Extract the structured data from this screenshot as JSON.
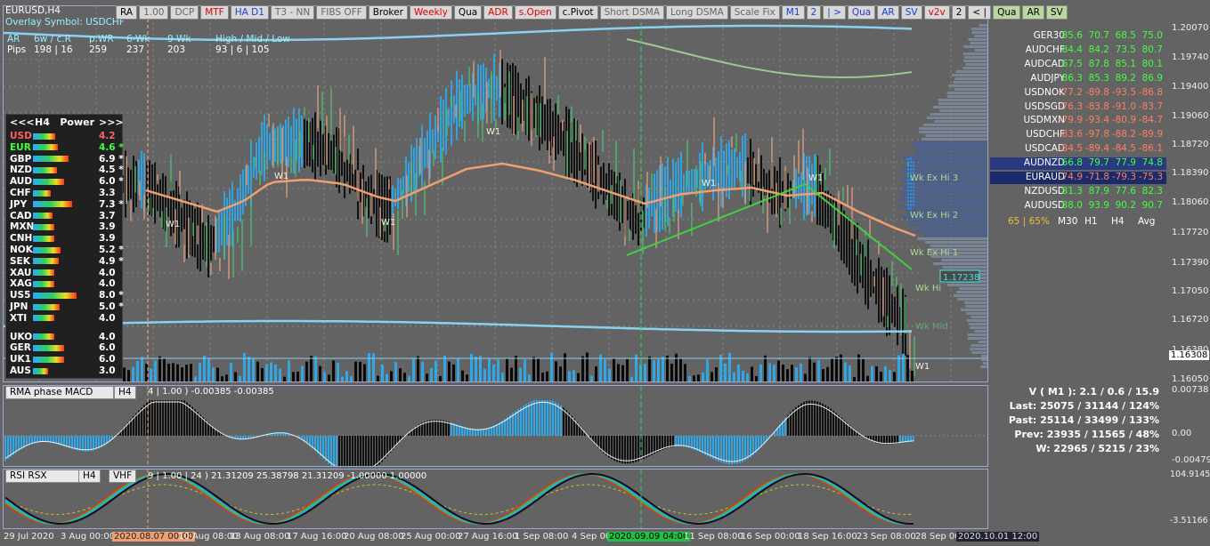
{
  "header": {
    "symbol": "EURUSD,H4",
    "overlay": "Overlay Symbol: USDCHF",
    "ar_label": "AR",
    "pips_label": "Pips",
    "cols": [
      {
        "h": "6w / c.R",
        "v": "198 | 16"
      },
      {
        "h": "p.WR",
        "v": "259"
      },
      {
        "h": "6-Wk",
        "v": "237"
      },
      {
        "h": "9-Wk",
        "v": "203"
      },
      {
        "h": "High / Mid / Low",
        "v": "93 | 6 | 105"
      }
    ]
  },
  "toolbar": [
    {
      "label": "RA",
      "style": ""
    },
    {
      "label": "1.00",
      "style": "gray"
    },
    {
      "label": "DCP",
      "style": "gray"
    },
    {
      "label": "MTF",
      "style": "red"
    },
    {
      "label": "HA D1",
      "style": "blue"
    },
    {
      "label": "T3 - NN",
      "style": "gray"
    },
    {
      "label": "FIBS OFF",
      "style": "gray"
    },
    {
      "label": "Broker",
      "style": ""
    },
    {
      "label": "Weekly",
      "style": "red"
    },
    {
      "label": "Qua",
      "style": ""
    },
    {
      "label": "ADR",
      "style": "red"
    },
    {
      "label": "s.Open",
      "style": "red"
    },
    {
      "label": "c.Pivot",
      "style": ""
    },
    {
      "label": "Short DSMA",
      "style": "gray"
    },
    {
      "label": "Long DSMA",
      "style": "gray"
    },
    {
      "label": "Scale Fix",
      "style": "gray"
    },
    {
      "label": "M1",
      "style": "blue"
    },
    {
      "label": "2",
      "style": "blue"
    },
    {
      "label": "| >",
      "style": "blue"
    },
    {
      "label": "Qua",
      "style": "blue"
    },
    {
      "label": "AR",
      "style": "blue"
    },
    {
      "label": "SV",
      "style": "blue"
    },
    {
      "label": "v2v",
      "style": "red"
    },
    {
      "label": "2",
      "style": ""
    },
    {
      "label": "< |",
      "style": ""
    },
    {
      "label": "Qua",
      "style": "green"
    },
    {
      "label": "AR",
      "style": "green"
    },
    {
      "label": "SV",
      "style": "green"
    }
  ],
  "price_axis": {
    "main": [
      "1.20070",
      "1.19740",
      "1.19400",
      "1.19060",
      "1.18720",
      "1.18390",
      "1.18060",
      "1.17720",
      "1.17390",
      "1.17050",
      "1.16720",
      "1.16380",
      "1.16050"
    ],
    "current_price": "1.16308",
    "macd": [
      "0.00738",
      "0.00",
      "-0.00479"
    ],
    "rsi": [
      "104.91454",
      "-3.51166"
    ]
  },
  "dates": {
    "items": [
      "29 Jul 2020",
      "3 Aug 00:00",
      "2020.08.07 00:00",
      "10 Aug 08:00",
      "13 Aug 08:00",
      "17 Aug 16:00",
      "20 Aug 08:00",
      "25 Aug 00:00",
      "27 Aug 16:00",
      "1 Sep 08:00",
      "4 Sep 00:00",
      "2020.09.09 04:00",
      "11 Sep 08:00",
      "16 Sep 00:00",
      "18 Sep 16:00",
      "23 Sep 08:00",
      "28 Sep 00:00",
      "2020.10.01 12:00"
    ]
  },
  "power": {
    "title": "H4   Power",
    "left_nav": "<<<",
    "right_nav": ">>>",
    "rows": [
      {
        "code": "USD",
        "val": "4.2",
        "star": "",
        "color": "#ff6060",
        "bar": 0.45
      },
      {
        "code": "EUR",
        "val": "4.6 *",
        "star": "",
        "color": "#40ff40",
        "bar": 0.5
      },
      {
        "code": "GBP",
        "val": "6.9 *",
        "star": "",
        "color": "#ffffff",
        "bar": 0.72
      },
      {
        "code": "NZD",
        "val": "4.5 *",
        "star": "",
        "color": "#ffffff",
        "bar": 0.48
      },
      {
        "code": "AUD",
        "val": "6.0 *",
        "star": "",
        "color": "#ffffff",
        "bar": 0.63
      },
      {
        "code": "CHF",
        "val": "3.3",
        "star": "",
        "color": "#ffffff",
        "bar": 0.35
      },
      {
        "code": "JPY",
        "val": "7.3 *",
        "star": "",
        "color": "#ffffff",
        "bar": 0.78
      },
      {
        "code": "CAD",
        "val": "3.7",
        "star": "",
        "color": "#ffffff",
        "bar": 0.4
      },
      {
        "code": "MXN",
        "val": "3.9",
        "star": "",
        "color": "#ffffff",
        "bar": 0.42
      },
      {
        "code": "CNH",
        "val": "3.9",
        "star": "",
        "color": "#ffffff",
        "bar": 0.42
      },
      {
        "code": "NOK",
        "val": "5.2 *",
        "star": "",
        "color": "#ffffff",
        "bar": 0.55
      },
      {
        "code": "SEK",
        "val": "4.9 *",
        "star": "",
        "color": "#ffffff",
        "bar": 0.52
      },
      {
        "code": "XAU",
        "val": "4.0",
        "star": "",
        "color": "#ffffff",
        "bar": 0.43
      },
      {
        "code": "XAG",
        "val": "4.0",
        "star": "",
        "color": "#ffffff",
        "bar": 0.43
      },
      {
        "code": "US5",
        "val": "8.0 *",
        "star": "",
        "color": "#ffffff",
        "bar": 0.88
      },
      {
        "code": "JPN",
        "val": "5.0 *",
        "star": "",
        "color": "#ffffff",
        "bar": 0.53
      },
      {
        "code": "XTI",
        "val": "4.0",
        "star": "",
        "color": "#ffffff",
        "bar": 0.43
      },
      {
        "code": "UKO",
        "val": "4.0",
        "star": "",
        "color": "#ffffff",
        "bar": 0.43
      },
      {
        "code": "GER",
        "val": "6.0",
        "star": "",
        "color": "#ffffff",
        "bar": 0.63
      },
      {
        "code": "UK1",
        "val": "6.0",
        "star": "",
        "color": "#ffffff",
        "bar": 0.63
      },
      {
        "code": "AUS",
        "val": "3.0",
        "star": "",
        "color": "#ffffff",
        "bar": 0.3
      }
    ]
  },
  "strength_table": {
    "rows": [
      {
        "sym": "GER30",
        "v": [
          "85.6",
          "70.7",
          "68.5",
          "75.0"
        ],
        "c": "#40ff40"
      },
      {
        "sym": "AUDCHF",
        "v": [
          "84.4",
          "84.2",
          "73.5",
          "80.7"
        ],
        "c": "#40ff40"
      },
      {
        "sym": "AUDCAD",
        "v": [
          "67.5",
          "87.8",
          "85.1",
          "80.1"
        ],
        "c": "#40ff40"
      },
      {
        "sym": "AUDJPY",
        "v": [
          "86.3",
          "85.3",
          "89.2",
          "86.9"
        ],
        "c": "#40ff40"
      },
      {
        "sym": "USDNOK",
        "v": [
          "-77.2",
          "-89.8",
          "-93.5",
          "-86.8"
        ],
        "c": "#ff8060"
      },
      {
        "sym": "USDSGD",
        "v": [
          "-76.3",
          "-83.8",
          "-91.0",
          "-83.7"
        ],
        "c": "#ff8060"
      },
      {
        "sym": "USDMXN",
        "v": [
          "-79.9",
          "-93.4",
          "-80.9",
          "-84.7"
        ],
        "c": "#ff8060"
      },
      {
        "sym": "USDCHF",
        "v": [
          "-83.6",
          "-97.8",
          "-88.2",
          "-89.9"
        ],
        "c": "#ff8060"
      },
      {
        "sym": "USDCAD",
        "v": [
          "-84.5",
          "-89.4",
          "-84.5",
          "-86.1"
        ],
        "c": "#ff8060"
      },
      {
        "sym": "AUDNZD",
        "v": [
          "66.8",
          "79.7",
          "77.9",
          "74.8"
        ],
        "c": "#40ff40"
      },
      {
        "sym": "EURAUD",
        "v": [
          "-74.9",
          "-71.8",
          "-79.3",
          "-75.3"
        ],
        "c": "#ff8060"
      },
      {
        "sym": "NZDUSD",
        "v": [
          "81.3",
          "87.9",
          "77.6",
          "82.3"
        ],
        "c": "#40ff40"
      },
      {
        "sym": "AUDUSD",
        "v": [
          "88.0",
          "93.9",
          "90.2",
          "90.7"
        ],
        "c": "#40ff40"
      }
    ],
    "footer": {
      "pct": "65 | 65%",
      "cols": [
        "M30",
        "H1",
        "H4",
        "Avg"
      ]
    }
  },
  "levels": [
    "Wk Ex Hi 3",
    "Wk Ex Hi 2",
    "Wk Ex Hi 1",
    "Wk Hi",
    "Wk Mid"
  ],
  "w1_labels": [
    "W1",
    "W1",
    "W1",
    "W1",
    "W1",
    "W1",
    "W1",
    "W1"
  ],
  "price_tag": "1.17238",
  "macd": {
    "name": "RMA phase MACD",
    "tf": "H4",
    "info": "4 | 1.00 ) -0.00385 -0.00385"
  },
  "rsi": {
    "name": "RSI RSX",
    "tf": "H4",
    "extra": "VHF",
    "info": "9 | 1.00 | 24 ) 21.31209 25.38798 21.31209 -1.00000 1.00000"
  },
  "stats": {
    "rows": [
      "V ( M1 ): 2.1 / 0.6 / 15.9",
      "Last: 25075 / 31144 / 124%",
      "Past: 25114 / 33499 / 133%",
      "Prev: 23935 / 11565 / 48%",
      "W: 22965 / 5215 / 23%"
    ]
  },
  "colors": {
    "bull": "#30a8e8",
    "bear": "#0a0a0a",
    "bg": "#636363"
  }
}
